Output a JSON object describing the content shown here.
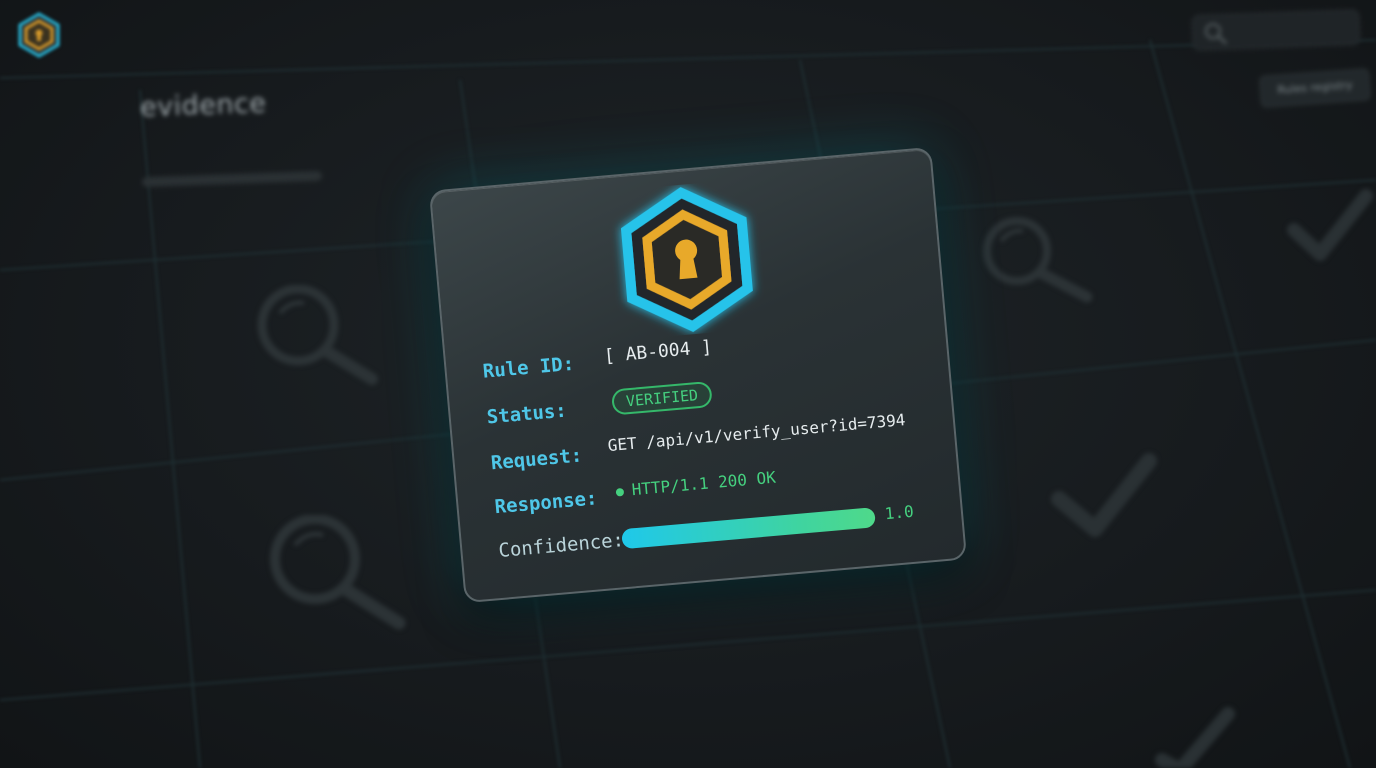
{
  "header": {
    "search_placeholder": "",
    "rules_button_label": "Rules registry"
  },
  "page": {
    "title": "evidence"
  },
  "card": {
    "rule_id_label": "Rule ID:",
    "rule_id_value": "[ AB-004 ]",
    "status_label": "Status:",
    "status_value": "VERIFIED",
    "request_label": "Request:",
    "request_value": "GET /api/v1/verify_user?id=7394",
    "response_label": "Response:",
    "response_value": "HTTP/1.1 200 OK",
    "confidence_label": "Confidence:",
    "confidence_value": 1.0,
    "confidence_text": "1.0"
  },
  "colors": {
    "accent_cyan": "#4fc7e8",
    "accent_gold": "#e8a92a",
    "status_green": "#45d07f",
    "background": "#15191c"
  },
  "icons": {
    "logo": "hexagon-keyhole-icon",
    "badge": "hexagon-keyhole-icon",
    "search": "search-icon",
    "magnifier": "magnifier-icon",
    "check": "checkmark-icon"
  }
}
